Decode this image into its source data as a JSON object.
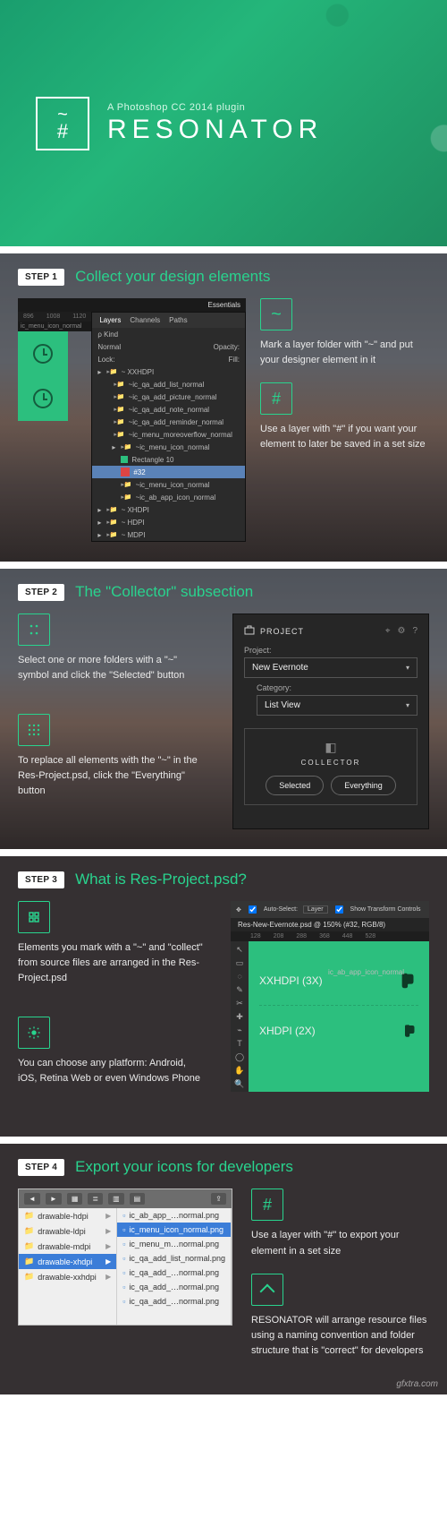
{
  "hero": {
    "tagline": "A Photoshop CC 2014 plugin",
    "title": "RESONATOR",
    "badge_top": "~",
    "badge_bottom": "#"
  },
  "step1": {
    "pill": "STEP 1",
    "title": "Collect your design elements",
    "tip1": "Mark a layer folder with \"~\" and put your designer element in it",
    "tip2": "Use a layer with \"#\" if you want your element to later be saved in a set size",
    "ruler": [
      "896",
      "1008",
      "1120"
    ],
    "essentials": "Essentials",
    "left_label": "ic_menu_icon_normal",
    "panel_tabs": [
      "Layers",
      "Channels",
      "Paths"
    ],
    "kind": "ρ Kind",
    "mode": "Normal",
    "opacity": "Opacity:",
    "lock": "Lock:",
    "fill": "Fill:",
    "layers": [
      "~ XXHDPI",
      "~ic_qa_add_list_normal",
      "~ic_qa_add_picture_normal",
      "~ic_qa_add_note_normal",
      "~ic_qa_add_reminder_normal",
      "~ic_menu_moreoverflow_normal",
      "~ic_menu_icon_normal",
      "Rectangle 10",
      "#32",
      "~ic_menu_icon_normal",
      "~ic_ab_app_icon_normal",
      "~ XHDPI",
      "~ HDPI",
      "~ MDPI"
    ],
    "selected_layer_index": 8
  },
  "step2": {
    "pill": "STEP 2",
    "title": "The \"Collector\" subsection",
    "tip1": "Select one or more folders with a \"~\" symbol and click the \"Selected\" button",
    "tip2": "To replace all elements with the \"~\" in the Res-Project.psd, click the \"Everything\" button",
    "panel_title": "PROJECT",
    "project_label": "Project:",
    "project_value": "New Evernote",
    "category_label": "Category:",
    "category_value": "List View",
    "collector_label": "COLLECTOR",
    "btn_selected": "Selected",
    "btn_everything": "Everything"
  },
  "step3": {
    "pill": "STEP 3",
    "title": "What is Res-Project.psd?",
    "tip1": "Elements you mark with a \"~\" and \"collect\" from source files are arranged in the Res-Project.psd",
    "tip2": "You can choose any platform: Android, iOS, Retina Web or even Windows Phone",
    "opt_auto": "Auto-Select:",
    "opt_layer": "Layer",
    "opt_show": "Show Transform Controls",
    "tab": "Res-New-Evernote.psd @ 150% (#32, RGB/8)",
    "ruler": [
      "128",
      "208",
      "288",
      "368",
      "448",
      "528"
    ],
    "right_label": "ic_ab_app_icon_normal",
    "row1": "XXHDPI (3X)",
    "row2": "XHDPI (2X)"
  },
  "step4": {
    "pill": "STEP 4",
    "title": "Export your icons for developers",
    "tip1": "Use a layer with \"#\" to export your element in a set size",
    "tip2": "RESONATOR will arrange resource files using a naming convention and folder structure that is \"correct\" for developers",
    "folders": [
      "drawable-hdpi",
      "drawable-ldpi",
      "drawable-mdpi",
      "drawable-xhdpi",
      "drawable-xxhdpi"
    ],
    "folders_selected_index": 3,
    "files": [
      "ic_ab_app_…normal.png",
      "ic_menu_icon_normal.png",
      "ic_menu_m…normal.png",
      "ic_qa_add_list_normal.png",
      "ic_qa_add_…normal.png",
      "ic_qa_add_…normal.png",
      "ic_qa_add_…normal.png"
    ],
    "files_selected_index": 1
  },
  "watermark": "gfxtra.com"
}
